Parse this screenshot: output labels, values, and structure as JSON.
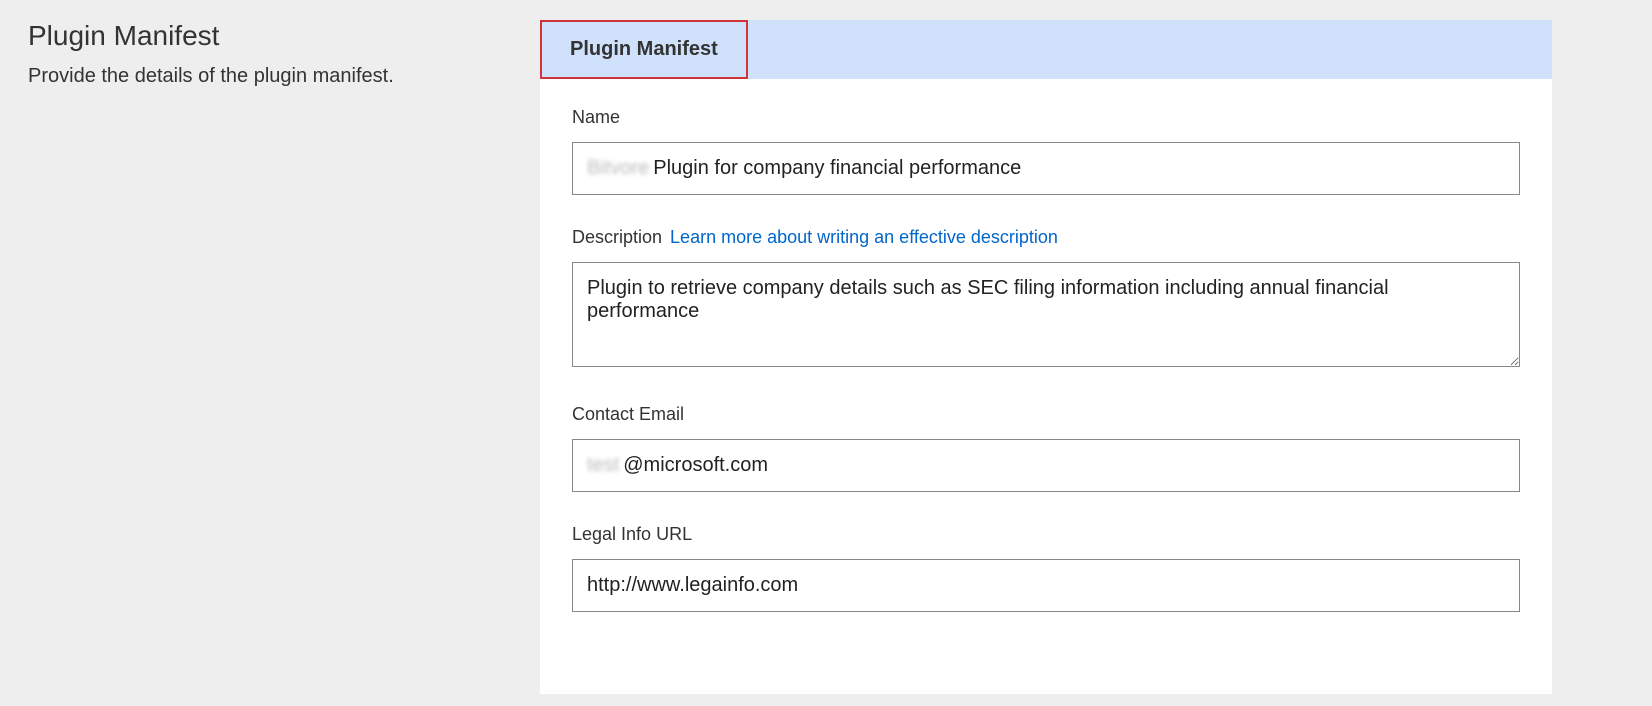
{
  "sidebar": {
    "title": "Plugin Manifest",
    "description": "Provide the details of the plugin manifest."
  },
  "tabs": [
    {
      "label": "Plugin Manifest",
      "active": true
    }
  ],
  "form": {
    "name": {
      "label": "Name",
      "blurred_prefix": "Bitvore",
      "value": "Plugin for company financial performance"
    },
    "description": {
      "label": "Description",
      "help_link": "Learn more about writing an effective description",
      "value": "Plugin to retrieve company details such as SEC filing information including annual financial performance"
    },
    "contact_email": {
      "label": "Contact Email",
      "blurred_prefix": "test",
      "value": "@microsoft.com"
    },
    "legal_info_url": {
      "label": "Legal Info URL",
      "value": "http://www.legainfo.com"
    }
  }
}
